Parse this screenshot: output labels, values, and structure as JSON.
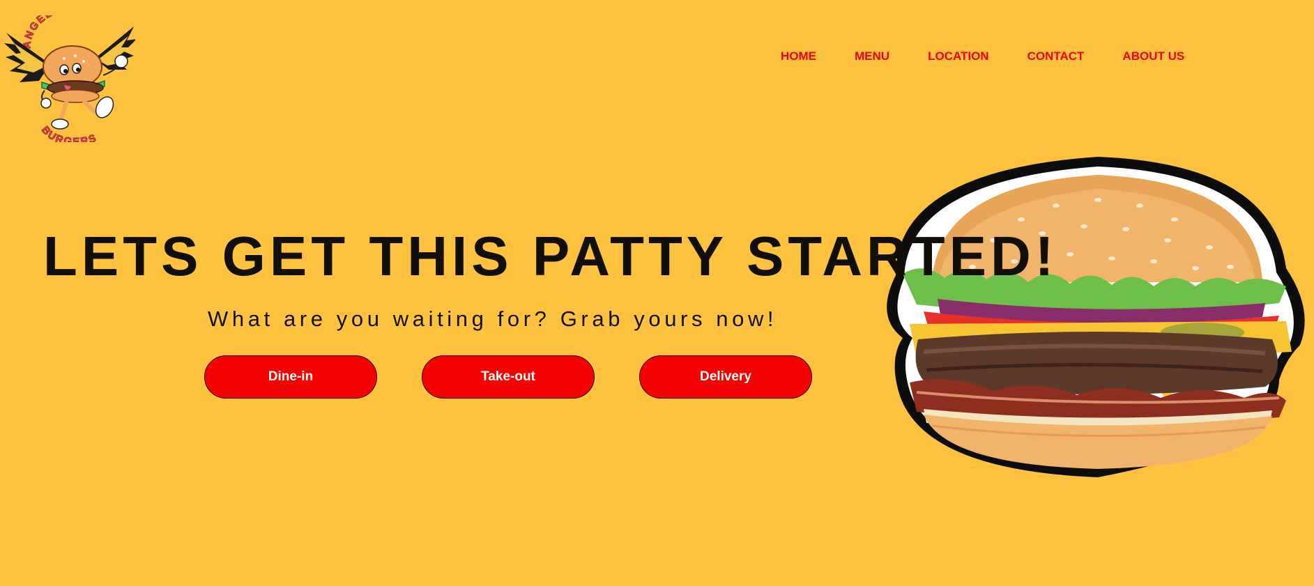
{
  "brand": {
    "logo_top_text": "ANGEL BABY",
    "logo_bottom_text": "BURGERS"
  },
  "nav": {
    "items": [
      {
        "label": "HOME"
      },
      {
        "label": "MENU"
      },
      {
        "label": "LOCATION"
      },
      {
        "label": "CONTACT"
      },
      {
        "label": "ABOUT US"
      }
    ]
  },
  "hero": {
    "headline": "LETS GET THIS PATTY STARTED!",
    "subheadline": "What are you waiting for? Grab yours now!",
    "buttons": [
      {
        "label": "Dine-in"
      },
      {
        "label": "Take-out"
      },
      {
        "label": "Delivery"
      }
    ],
    "image_icon": "burger-photo"
  },
  "colors": {
    "background": "#FFC23F",
    "accent": "#F2000A",
    "button": "#F60000",
    "text": "#120E08"
  }
}
